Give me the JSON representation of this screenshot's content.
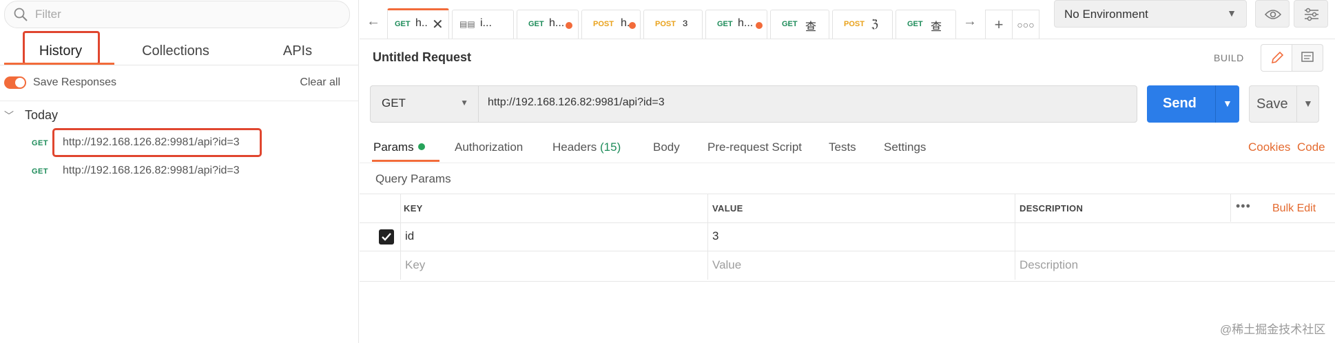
{
  "sidebar": {
    "search_placeholder": "Filter",
    "tabs": [
      "History",
      "Collections",
      "APIs"
    ],
    "save_responses_label": "Save Responses",
    "clear_all_label": "Clear all",
    "group_label": "Today",
    "history": [
      {
        "method": "GET",
        "url": "http://192.168.126.82:9981/api?id=3"
      },
      {
        "method": "GET",
        "url": "http://192.168.126.82:9981/api?id=3"
      }
    ]
  },
  "tabbar": {
    "tabs": [
      {
        "method": "GET",
        "name": "h..",
        "state": "active-close"
      },
      {
        "method": "",
        "name": "i...",
        "state": "icon"
      },
      {
        "method": "GET",
        "name": "h...",
        "state": "unsaved"
      },
      {
        "method": "POST",
        "name": "h.",
        "state": "unsaved"
      },
      {
        "method": "POST",
        "name": "ɜ",
        "state": ""
      },
      {
        "method": "GET",
        "name": "h...",
        "state": "unsaved"
      },
      {
        "method": "GET",
        "name": "查",
        "state": ""
      },
      {
        "method": "POST",
        "name": "ℨ",
        "state": ""
      },
      {
        "method": "GET",
        "name": "查",
        "state": ""
      }
    ],
    "environment": "No Environment"
  },
  "request": {
    "title": "Untitled Request",
    "build_label": "BUILD",
    "method": "GET",
    "url": "http://192.168.126.82:9981/api?id=3",
    "send_label": "Send",
    "save_label": "Save",
    "tabs": {
      "params": "Params",
      "authorization": "Authorization",
      "headers": "Headers",
      "headers_count": "(15)",
      "body": "Body",
      "prerequest": "Pre-request Script",
      "tests": "Tests",
      "settings": "Settings"
    },
    "cookies_label": "Cookies",
    "code_label": "Code",
    "query_params_label": "Query Params",
    "columns": {
      "key": "KEY",
      "value": "VALUE",
      "description": "DESCRIPTION"
    },
    "bulk_edit_label": "Bulk Edit",
    "params": [
      {
        "key": "id",
        "value": "3",
        "description": "",
        "enabled": true
      }
    ],
    "placeholders": {
      "key": "Key",
      "value": "Value",
      "description": "Description"
    }
  },
  "watermark": "@稀土掘金技术社区",
  "colors": {
    "accent": "#f26b3a",
    "send": "#2b7de9",
    "get": "#1e8c5a",
    "post": "#e9a21b",
    "highlight": "#e0462f"
  }
}
